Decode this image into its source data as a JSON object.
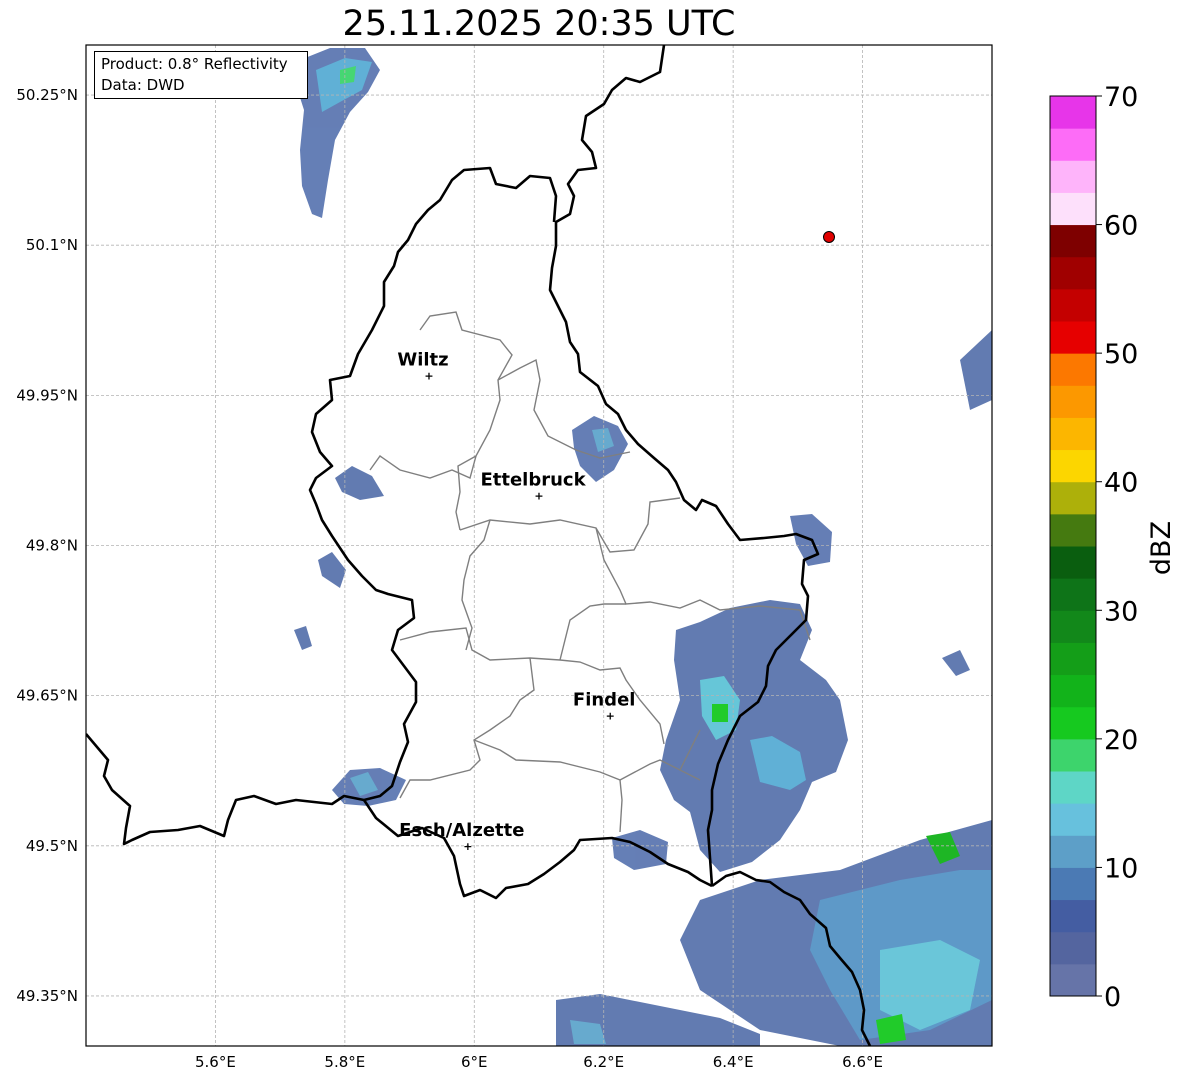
{
  "title": "25.11.2025 20:35 UTC",
  "info": {
    "product": "Product: 0.8° Reflectivity",
    "data": "Data: DWD"
  },
  "axes": {
    "lon_ticks": [
      "5.6°E",
      "5.8°E",
      "6°E",
      "6.2°E",
      "6.4°E",
      "6.6°E"
    ],
    "lat_ticks": [
      "50.25°N",
      "50.1°N",
      "49.95°N",
      "49.8°N",
      "49.65°N",
      "49.5°N",
      "49.35°N"
    ]
  },
  "cities": [
    {
      "name": "Wiltz",
      "lon": 5.93,
      "lat": 49.97
    },
    {
      "name": "Ettelbruck",
      "lon": 6.1,
      "lat": 49.85
    },
    {
      "name": "Findel",
      "lon": 6.21,
      "lat": 49.63
    },
    {
      "name": "Esch/Alzette",
      "lon": 5.99,
      "lat": 49.5
    }
  ],
  "colorbar": {
    "label": "dBZ",
    "ticks": [
      "0",
      "10",
      "20",
      "30",
      "40",
      "50",
      "60",
      "70"
    ],
    "colors": [
      "#6674a8",
      "#54659f",
      "#445da2",
      "#4b7ab4",
      "#5d9fc8",
      "#67c1dd",
      "#5ed6c6",
      "#3dd46c",
      "#16c91f",
      "#12b31a",
      "#149e18",
      "#12881a",
      "#0e7418",
      "#0a5e0f",
      "#457a10",
      "#adb00a",
      "#fcd600",
      "#fcb600",
      "#fc9800",
      "#fc7800",
      "#e60000",
      "#c40000",
      "#a00000",
      "#7e0000",
      "#fde0fb",
      "#feb4fa",
      "#fd6cf7",
      "#e735e9"
    ]
  },
  "colors": {
    "frame": "#000000",
    "grid": "#b4b4b4",
    "site_marker": "#e00000"
  }
}
